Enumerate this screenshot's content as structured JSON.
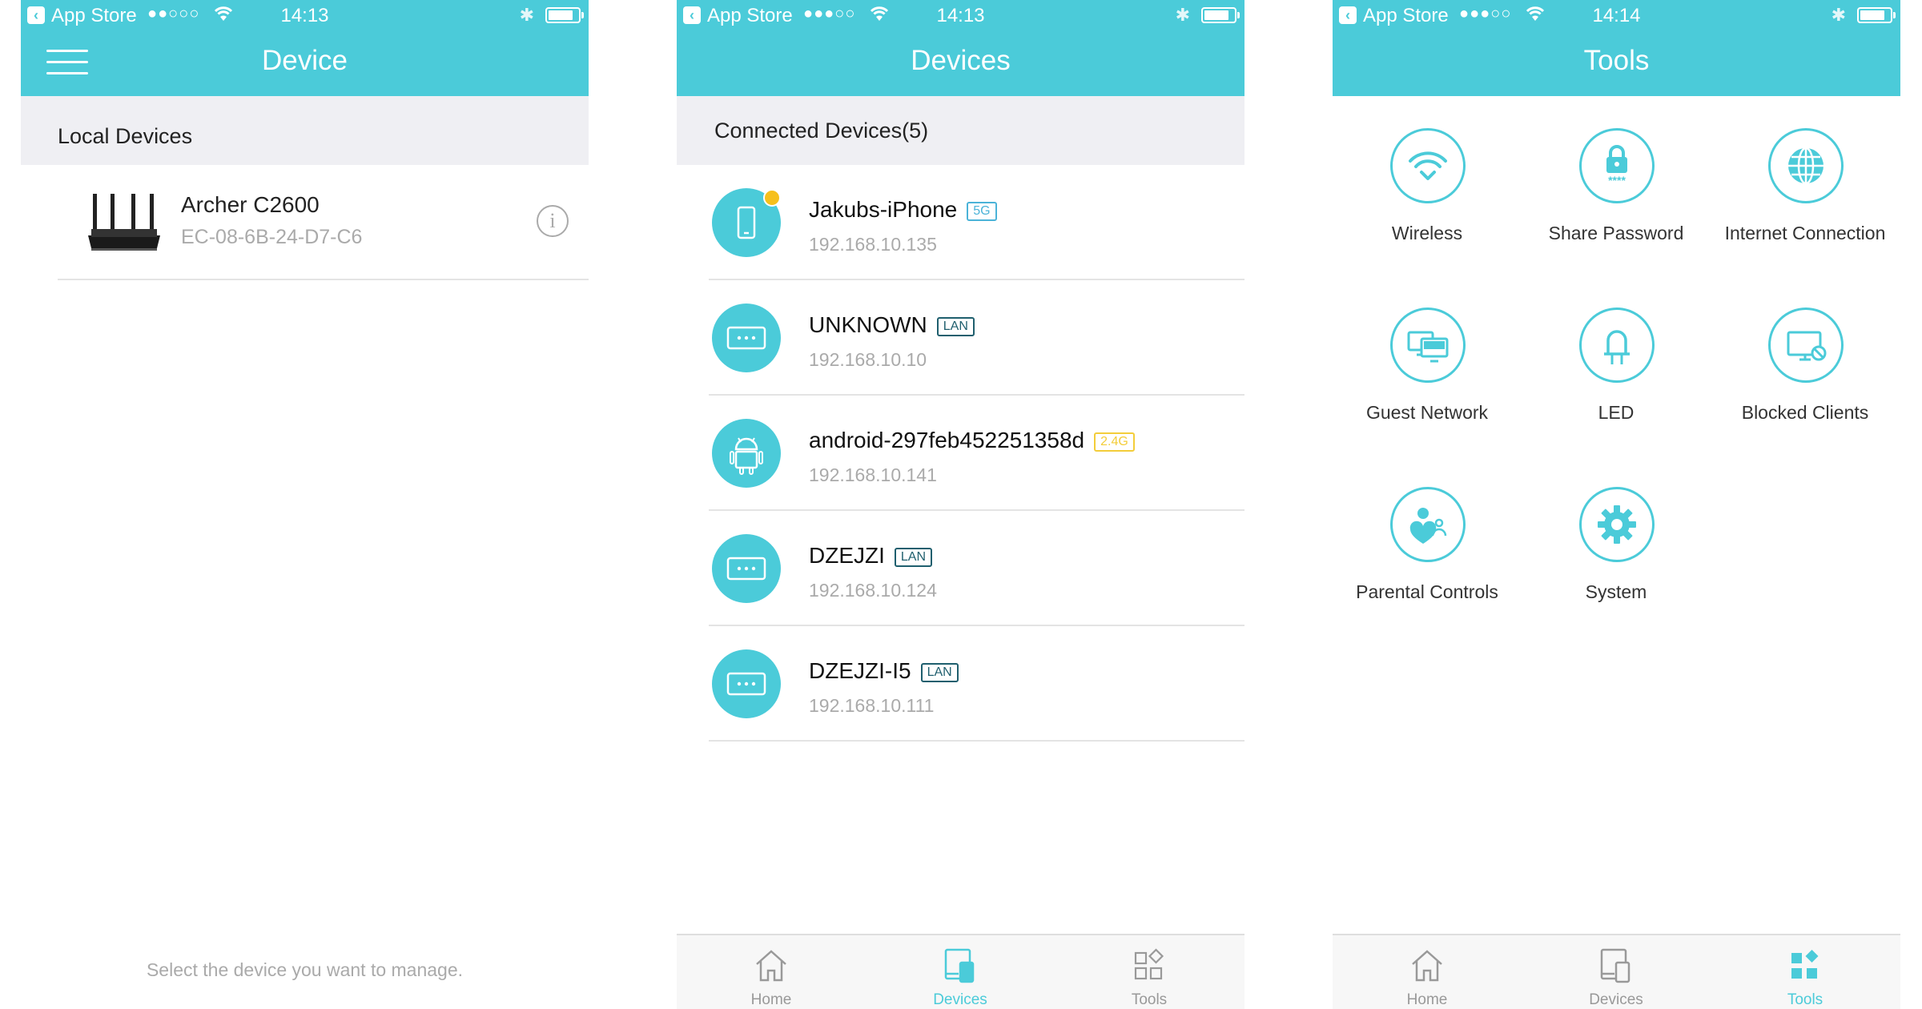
{
  "status_bars": [
    {
      "carrier": "App Store",
      "signal": "●●○○○",
      "time": "14:13"
    },
    {
      "carrier": "App Store",
      "signal": "●●●○○",
      "time": "14:13"
    },
    {
      "carrier": "App Store",
      "signal": "●●●○○",
      "time": "14:14"
    }
  ],
  "panel1": {
    "title": "Device",
    "section": "Local Devices",
    "device": {
      "name": "Archer C2600",
      "mac": "EC-08-6B-24-D7-C6",
      "info_icon": "i"
    },
    "hint": "Select the device you want to manage."
  },
  "panel2": {
    "title": "Devices",
    "section": "Connected Devices(5)",
    "devices": [
      {
        "name": "Jakubs-iPhone",
        "band": "5G",
        "ip": "192.168.10.135",
        "icon": "phone-icon"
      },
      {
        "name": "UNKNOWN",
        "band": "LAN",
        "ip": "192.168.10.10",
        "icon": "generic-device-icon"
      },
      {
        "name": "android-297feb452251358d",
        "band": "2.4G",
        "ip": "192.168.10.141",
        "icon": "android-icon"
      },
      {
        "name": "DZEJZI",
        "band": "LAN",
        "ip": "192.168.10.124",
        "icon": "generic-device-icon"
      },
      {
        "name": "DZEJZI-I5",
        "band": "LAN",
        "ip": "192.168.10.111",
        "icon": "generic-device-icon"
      }
    ]
  },
  "panel3": {
    "title": "Tools",
    "tools": [
      {
        "label": "Wireless",
        "icon": "wifi-icon"
      },
      {
        "label": "Share Password",
        "icon": "lock-icon"
      },
      {
        "label": "Internet Connection",
        "icon": "globe-icon"
      },
      {
        "label": "Guest Network",
        "icon": "guest-network-icon"
      },
      {
        "label": "LED",
        "icon": "led-icon"
      },
      {
        "label": "Blocked Clients",
        "icon": "blocked-monitor-icon"
      },
      {
        "label": "Parental Controls",
        "icon": "parental-icon"
      },
      {
        "label": "System",
        "icon": "gear-icon"
      }
    ]
  },
  "tabbar": {
    "home": "Home",
    "devices": "Devices",
    "tools": "Tools"
  },
  "colors": {
    "accent": "#4bcbd9",
    "badge": "#f6c01c",
    "tag_5g": "#4bb3d8",
    "tag_24g": "#f3cd3a",
    "tag_lan": "#1f5f6e"
  }
}
